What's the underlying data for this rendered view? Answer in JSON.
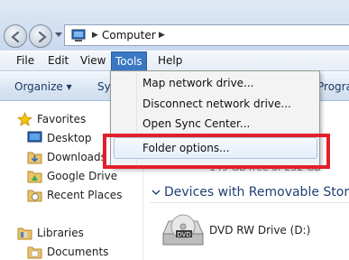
{
  "address": {
    "location": "Computer"
  },
  "menubar": {
    "file": "File",
    "edit": "Edit",
    "view": "View",
    "tools": "Tools",
    "help": "Help"
  },
  "commandbar": {
    "organize": "Organize ▾",
    "sy": "Sy",
    "progra": "Progra"
  },
  "navpane": {
    "favorites": "Favorites",
    "desktop": "Desktop",
    "downloads": "Downloads",
    "google_drive": "Google Drive",
    "recent_places": "Recent Places",
    "libraries": "Libraries",
    "documents": "Documents"
  },
  "content": {
    "free_space": "149 GB free of 232 GB",
    "group_title": "Devices with Removable Storag",
    "dvd_label": "DVD RW Drive (D:)"
  },
  "tools_menu": {
    "items": [
      "Map network drive...",
      "Disconnect network drive...",
      "Open Sync Center...",
      "Folder options..."
    ]
  },
  "colors": {
    "highlight_frame": "#e2202b",
    "menu_active": "#3a78c4"
  }
}
